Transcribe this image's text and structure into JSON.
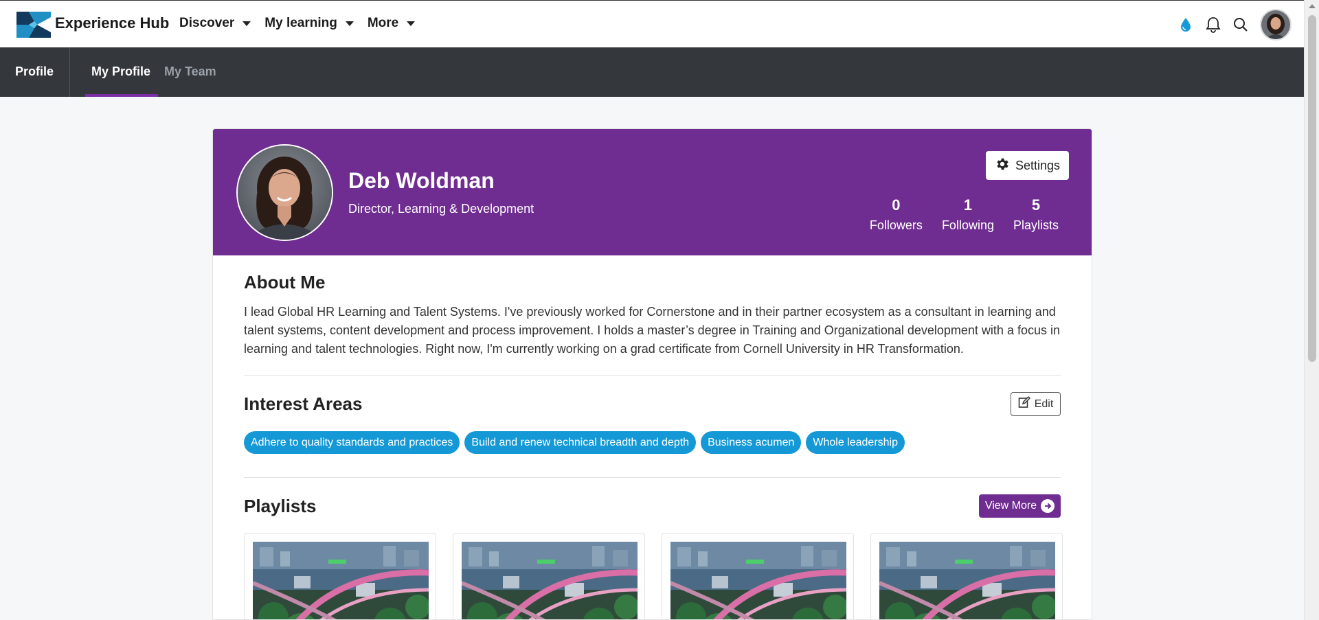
{
  "topnav": {
    "brand": "Experience Hub",
    "menu": [
      {
        "label": "Discover"
      },
      {
        "label": "My learning"
      },
      {
        "label": "More"
      }
    ]
  },
  "subnav": {
    "section": "Profile",
    "tabs": [
      {
        "label": "My Profile",
        "active": true
      },
      {
        "label": "My Team",
        "active": false
      }
    ]
  },
  "profile": {
    "name": "Deb Woldman",
    "role": "Director, Learning & Development",
    "settings_label": "Settings",
    "stats": [
      {
        "value": "0",
        "label": "Followers"
      },
      {
        "value": "1",
        "label": "Following"
      },
      {
        "value": "5",
        "label": "Playlists"
      }
    ]
  },
  "about": {
    "title": "About Me",
    "text": "I lead Global HR Learning and Talent Systems. I've previously worked for Cornerstone and in their partner ecosystem as a consultant in learning and talent systems, content development and process improvement. I holds a master’s degree in Training and Organizational development with a focus in learning and talent technologies. Right now, I'm currently working on a grad certificate from Cornell University in HR Transformation."
  },
  "interests": {
    "title": "Interest Areas",
    "edit_label": "Edit",
    "items": [
      "Adhere to quality standards and practices",
      "Build and renew technical breadth and depth",
      "Business acumen",
      "Whole leadership"
    ]
  },
  "playlists": {
    "title": "Playlists",
    "view_more_label": "View More",
    "count_visible": 4
  },
  "colors": {
    "brand_purple": "#6f2c91",
    "chip_blue": "#1599d6",
    "subnav_bg": "#34373c",
    "logo_teal": "#1f8fc4",
    "logo_navy": "#123a5c"
  },
  "icons": [
    "droplet-icon",
    "bell-icon",
    "search-icon",
    "gear-icon",
    "edit-icon",
    "arrow-right-circle-icon",
    "chevron-down-icon"
  ]
}
